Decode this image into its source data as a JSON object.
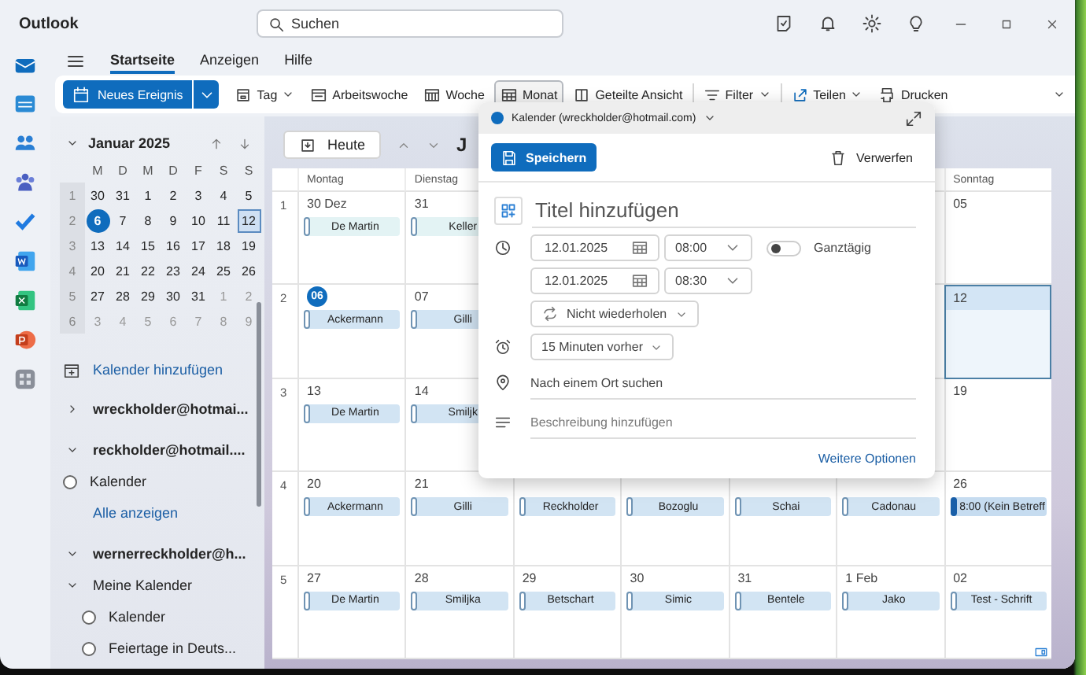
{
  "window": {
    "title": "Outlook",
    "search_placeholder": "Suchen"
  },
  "ribbon_tabs": [
    {
      "label": "Startseite",
      "selected": true
    },
    {
      "label": "Anzeigen",
      "selected": false
    },
    {
      "label": "Hilfe",
      "selected": false
    }
  ],
  "new_event": "Neues Ereignis",
  "toolbar": [
    {
      "label": "Tag",
      "selected": false,
      "dropdown": true
    },
    {
      "label": "Arbeitswoche",
      "selected": false,
      "dropdown": false
    },
    {
      "label": "Woche",
      "selected": false,
      "dropdown": false
    },
    {
      "label": "Monat",
      "selected": true,
      "dropdown": false
    },
    {
      "label": "Geteilte Ansicht",
      "selected": false,
      "dropdown": false
    },
    {
      "label": "Filter",
      "selected": false,
      "dropdown": true
    },
    {
      "label": "Teilen",
      "selected": false,
      "dropdown": true
    },
    {
      "label": "Drucken",
      "selected": false,
      "dropdown": false
    }
  ],
  "mini_calendar": {
    "title": "Januar 2025",
    "weekdays": [
      "M",
      "D",
      "M",
      "D",
      "F",
      "S",
      "S"
    ],
    "weeks": [
      {
        "number": "1",
        "days": [
          {
            "label": "30",
            "today": false,
            "selected": false,
            "dimmed": false
          },
          {
            "label": "31",
            "today": false,
            "selected": false,
            "dimmed": false
          },
          {
            "label": "1",
            "today": false,
            "selected": false,
            "dimmed": false
          },
          {
            "label": "2",
            "today": false,
            "selected": false,
            "dimmed": false
          },
          {
            "label": "3",
            "today": false,
            "selected": false,
            "dimmed": false
          },
          {
            "label": "4",
            "today": false,
            "selected": false,
            "dimmed": false
          },
          {
            "label": "5",
            "today": false,
            "selected": false,
            "dimmed": false
          }
        ]
      },
      {
        "number": "2",
        "days": [
          {
            "label": "6",
            "today": true,
            "selected": false,
            "dimmed": false
          },
          {
            "label": "7",
            "today": false,
            "selected": false,
            "dimmed": false
          },
          {
            "label": "8",
            "today": false,
            "selected": false,
            "dimmed": false
          },
          {
            "label": "9",
            "today": false,
            "selected": false,
            "dimmed": false
          },
          {
            "label": "10",
            "today": false,
            "selected": false,
            "dimmed": false
          },
          {
            "label": "11",
            "today": false,
            "selected": false,
            "dimmed": false
          },
          {
            "label": "12",
            "today": false,
            "selected": true,
            "dimmed": false
          }
        ]
      },
      {
        "number": "3",
        "days": [
          {
            "label": "13",
            "today": false,
            "selected": false,
            "dimmed": false
          },
          {
            "label": "14",
            "today": false,
            "selected": false,
            "dimmed": false
          },
          {
            "label": "15",
            "today": false,
            "selected": false,
            "dimmed": false
          },
          {
            "label": "16",
            "today": false,
            "selected": false,
            "dimmed": false
          },
          {
            "label": "17",
            "today": false,
            "selected": false,
            "dimmed": false
          },
          {
            "label": "18",
            "today": false,
            "selected": false,
            "dimmed": false
          },
          {
            "label": "19",
            "today": false,
            "selected": false,
            "dimmed": false
          }
        ]
      },
      {
        "number": "4",
        "days": [
          {
            "label": "20",
            "today": false,
            "selected": false,
            "dimmed": false
          },
          {
            "label": "21",
            "today": false,
            "selected": false,
            "dimmed": false
          },
          {
            "label": "22",
            "today": false,
            "selected": false,
            "dimmed": false
          },
          {
            "label": "23",
            "today": false,
            "selected": false,
            "dimmed": false
          },
          {
            "label": "24",
            "today": false,
            "selected": false,
            "dimmed": false
          },
          {
            "label": "25",
            "today": false,
            "selected": false,
            "dimmed": false
          },
          {
            "label": "26",
            "today": false,
            "selected": false,
            "dimmed": false
          }
        ]
      },
      {
        "number": "5",
        "days": [
          {
            "label": "27",
            "today": false,
            "selected": false,
            "dimmed": false
          },
          {
            "label": "28",
            "today": false,
            "selected": false,
            "dimmed": false
          },
          {
            "label": "29",
            "today": false,
            "selected": false,
            "dimmed": false
          },
          {
            "label": "30",
            "today": false,
            "selected": false,
            "dimmed": false
          },
          {
            "label": "31",
            "today": false,
            "selected": false,
            "dimmed": false
          },
          {
            "label": "1",
            "today": false,
            "selected": false,
            "dimmed": true
          },
          {
            "label": "2",
            "today": false,
            "selected": false,
            "dimmed": true
          }
        ]
      },
      {
        "number": "6",
        "days": [
          {
            "label": "3",
            "today": false,
            "selected": false,
            "dimmed": true
          },
          {
            "label": "4",
            "today": false,
            "selected": false,
            "dimmed": true
          },
          {
            "label": "5",
            "today": false,
            "selected": false,
            "dimmed": true
          },
          {
            "label": "6",
            "today": false,
            "selected": false,
            "dimmed": true
          },
          {
            "label": "7",
            "today": false,
            "selected": false,
            "dimmed": true
          },
          {
            "label": "8",
            "today": false,
            "selected": false,
            "dimmed": true
          },
          {
            "label": "9",
            "today": false,
            "selected": false,
            "dimmed": true
          }
        ]
      }
    ]
  },
  "sidebar": {
    "add_calendar": "Kalender hinzufügen",
    "accounts": [
      {
        "name": "wreckholder@hotmai...",
        "expanded": false
      },
      {
        "name": "reckholder@hotmail....",
        "expanded": true,
        "calendars": [
          {
            "label": "Kalender",
            "checked": false
          }
        ],
        "link": "Alle anzeigen"
      },
      {
        "name": "wernerreckholder@h...",
        "expanded": true,
        "groups": [
          {
            "name": "Meine Kalender",
            "expanded": true,
            "calendars": [
              {
                "label": "Kalender",
                "checked": false
              },
              {
                "label": "Feiertage in Deuts...",
                "checked": false
              }
            ]
          }
        ]
      }
    ]
  },
  "calendar": {
    "today_button": "Heute",
    "month_title": "J",
    "weekdays": [
      "Montag",
      "Dienstag",
      "Sonntag"
    ],
    "rows": [
      {
        "week": "1",
        "cells": [
          {
            "date": "30 Dez",
            "today": false,
            "selected": false,
            "events": [
              {
                "title": "De Martin",
                "kind": "past"
              }
            ]
          },
          {
            "date": "31",
            "today": false,
            "selected": false,
            "events": [
              {
                "title": "Keller",
                "kind": "past"
              }
            ]
          },
          {},
          {},
          {},
          {},
          {
            "date": "05",
            "today": false,
            "selected": false
          }
        ]
      },
      {
        "week": "2",
        "cells": [
          {
            "date": "06",
            "today": true,
            "selected": false,
            "events": [
              {
                "title": "Ackermann",
                "kind": "normal"
              }
            ]
          },
          {
            "date": "07",
            "today": false,
            "selected": false,
            "events": [
              {
                "title": "Gilli",
                "kind": "normal"
              }
            ]
          },
          {},
          {},
          {},
          {},
          {
            "date": "12",
            "today": false,
            "selected": true
          }
        ]
      },
      {
        "week": "3",
        "cells": [
          {
            "date": "13",
            "today": false,
            "selected": false,
            "events": [
              {
                "title": "De Martin",
                "kind": "normal"
              }
            ]
          },
          {
            "date": "14",
            "today": false,
            "selected": false,
            "events": [
              {
                "title": "Smiljk",
                "kind": "normal"
              }
            ]
          },
          {},
          {},
          {},
          {},
          {
            "date": "19",
            "today": false,
            "selected": false
          }
        ]
      },
      {
        "week": "4",
        "cells": [
          {
            "date": "20",
            "today": false,
            "selected": false,
            "events": [
              {
                "title": "Ackermann",
                "kind": "normal"
              }
            ]
          },
          {
            "date": "21",
            "today": false,
            "selected": false,
            "events": [
              {
                "title": "Gilli",
                "kind": "normal"
              }
            ]
          },
          {
            "events": [
              {
                "title": "Reckholder",
                "kind": "normal"
              }
            ]
          },
          {
            "events": [
              {
                "title": "Bozoglu",
                "kind": "normal"
              }
            ]
          },
          {
            "events": [
              {
                "title": "Schai",
                "kind": "normal"
              }
            ]
          },
          {
            "events": [
              {
                "title": "Cadonau",
                "kind": "normal"
              }
            ]
          },
          {
            "date": "26",
            "today": false,
            "selected": false,
            "events": [
              {
                "title": "8:00 (Kein Betreff",
                "kind": "timed"
              }
            ]
          }
        ]
      },
      {
        "week": "5",
        "cells": [
          {
            "date": "27",
            "today": false,
            "selected": false,
            "events": [
              {
                "title": "De Martin",
                "kind": "normal"
              }
            ]
          },
          {
            "date": "28",
            "today": false,
            "selected": false,
            "events": [
              {
                "title": "Smiljka",
                "kind": "normal"
              }
            ]
          },
          {
            "date": "29",
            "today": false,
            "selected": false,
            "events": [
              {
                "title": "Betschart",
                "kind": "normal"
              }
            ]
          },
          {
            "date": "30",
            "today": false,
            "selected": false,
            "events": [
              {
                "title": "Simic",
                "kind": "normal"
              }
            ]
          },
          {
            "date": "31",
            "today": false,
            "selected": false,
            "events": [
              {
                "title": "Bentele",
                "kind": "normal"
              }
            ]
          },
          {
            "date": "1 Feb",
            "today": false,
            "selected": false,
            "events": [
              {
                "title": "Jako",
                "kind": "normal"
              }
            ]
          },
          {
            "date": "02",
            "today": false,
            "selected": false,
            "events": [
              {
                "title": "Test - Schrift",
                "kind": "normal"
              }
            ]
          }
        ]
      }
    ]
  },
  "popup": {
    "calendar": "Kalender (wreckholder@hotmail.com)",
    "save": "Speichern",
    "discard": "Verwerfen",
    "title_placeholder": "Titel hinzufügen",
    "start_date": "12.01.2025",
    "start_time": "08:00",
    "end_date": "12.01.2025",
    "end_time": "08:30",
    "all_day": {
      "label": "Ganztägig",
      "on": false
    },
    "repeat": "Nicht wiederholen",
    "reminder": "15 Minuten vorher",
    "location_placeholder": "Nach einem Ort suchen",
    "description_placeholder": "Beschreibung hinzufügen",
    "more_options": "Weitere Optionen"
  }
}
